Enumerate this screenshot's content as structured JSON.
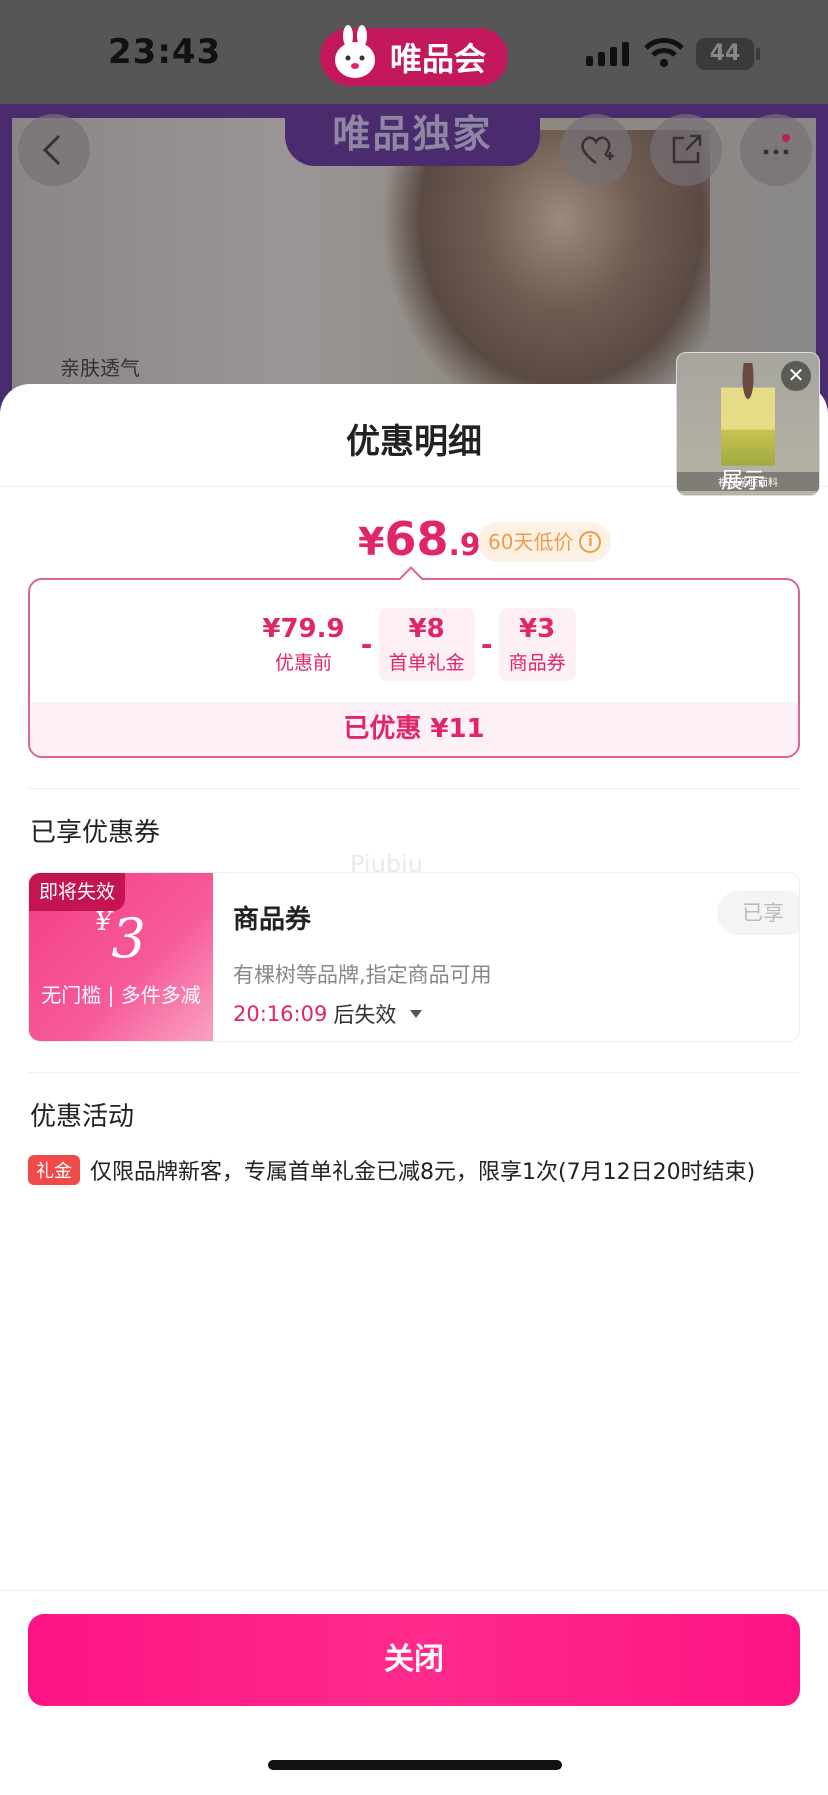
{
  "status_bar": {
    "time": "23:43",
    "app_name": "唯品会",
    "battery": "44"
  },
  "background": {
    "banner_tag": "唯品独家",
    "caption": "亲肤透气",
    "icons": [
      "back-icon",
      "favorite-add-icon",
      "share-icon",
      "more-icon"
    ]
  },
  "floating_thumb": {
    "caption": "裸感亲肤面料",
    "overlay_text": "展示",
    "close_label": "✕"
  },
  "sheet": {
    "title": "优惠明细",
    "final_price": {
      "currency": "¥",
      "integer": "68",
      "decimal": ".9"
    },
    "low_price_badge": "60天低价",
    "breakdown": {
      "items": [
        {
          "amount": "¥79.9",
          "label": "优惠前"
        },
        {
          "amount": "¥8",
          "label": "首单礼金"
        },
        {
          "amount": "¥3",
          "label": "商品券"
        }
      ],
      "operators": [
        "-",
        "-"
      ],
      "total": "已优惠 ¥11"
    },
    "coupon_section": {
      "heading": "已享优惠券",
      "watermark": "Piubiu",
      "coupon": {
        "expiring_tag": "即将失效",
        "currency": "¥",
        "value": "3",
        "condition": "无门槛 | 多件多减",
        "name": "商品券",
        "description": "有棵树等品牌,指定商品可用",
        "countdown": "20:16:09",
        "countdown_suffix": "后失效",
        "status": "已享"
      }
    },
    "activity_section": {
      "heading": "优惠活动",
      "tag": "礼金",
      "text": "仅限品牌新客，专属首单礼金已减8元，限享1次(7月12日20时结束)"
    },
    "close_button": "关闭"
  },
  "colors": {
    "accent": "#e0256b",
    "button": "#fd1484",
    "badge_bg": "#fdf1e3",
    "badge_text": "#ee9b4b",
    "tag_red": "#f04a4a"
  }
}
